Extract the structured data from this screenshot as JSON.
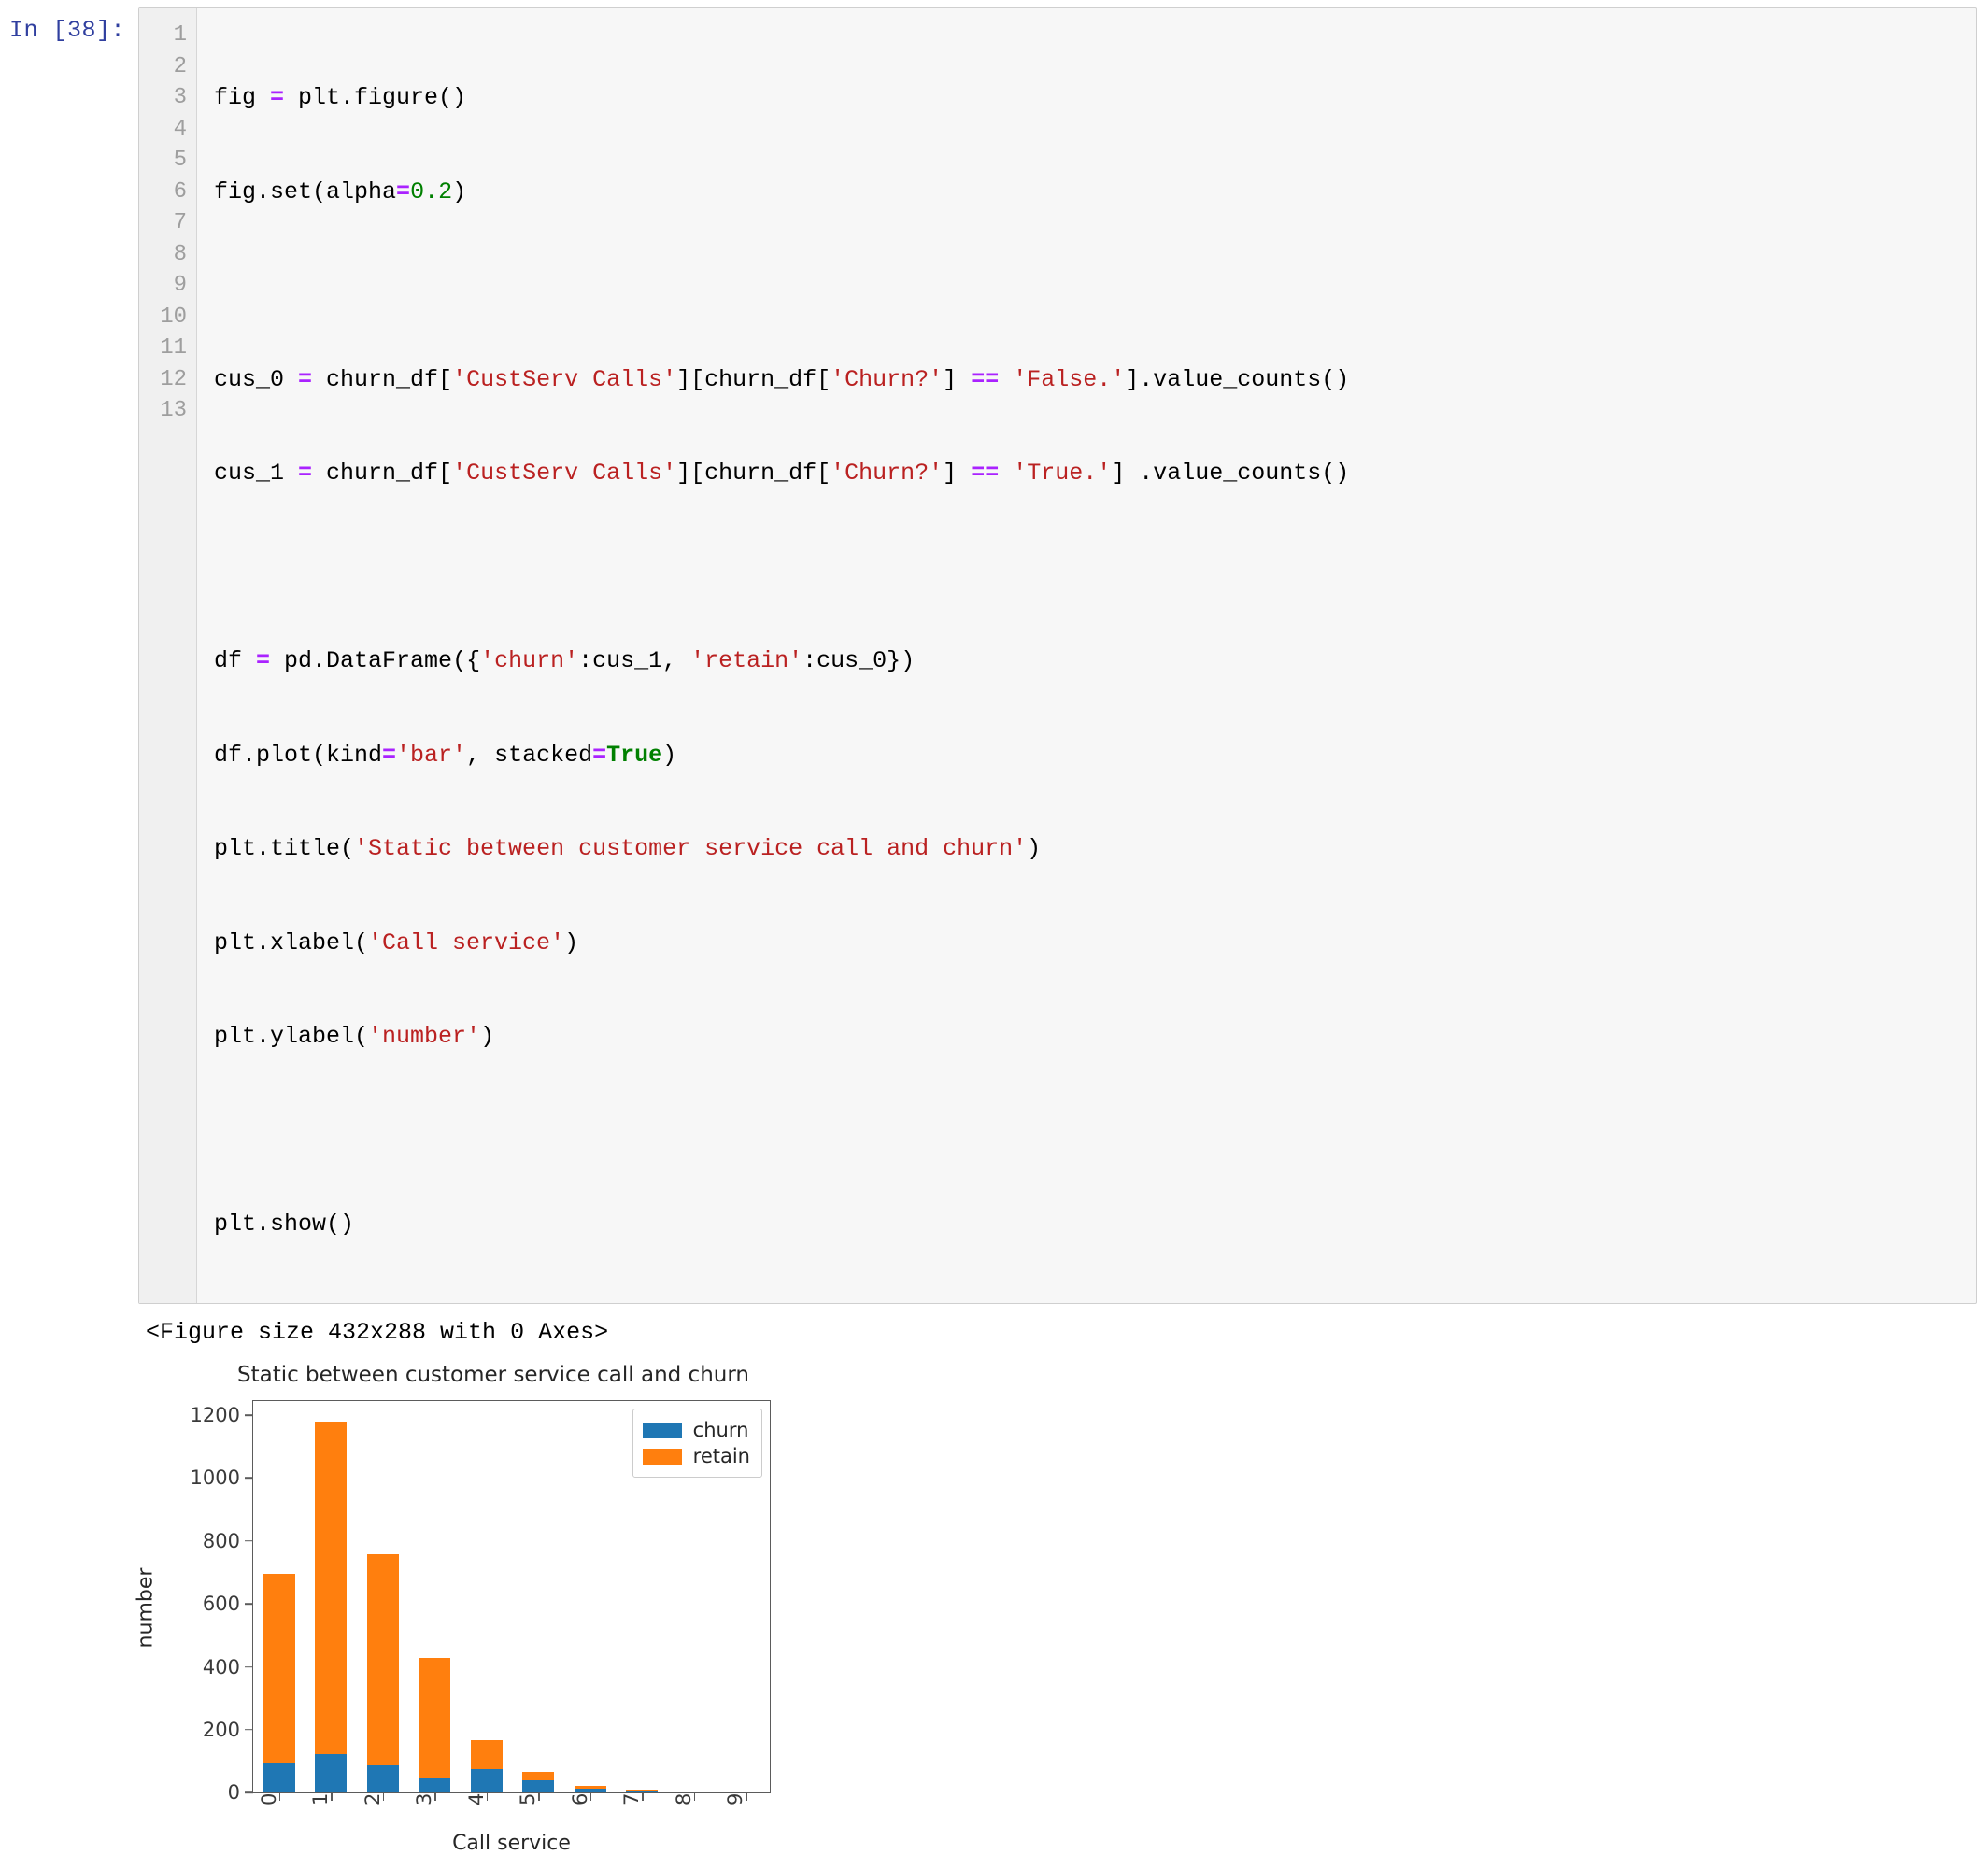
{
  "cell": {
    "prompt": "In [38]:",
    "line_numbers": [
      "1",
      "2",
      "3",
      "4",
      "5",
      "6",
      "7",
      "8",
      "9",
      "10",
      "11",
      "12",
      "13"
    ],
    "code_lines": [
      "fig = plt.figure()",
      "fig.set(alpha=0.2)",
      "",
      "cus_0 = churn_df['CustServ Calls'][churn_df['Churn?'] == 'False.'].value_counts()",
      "cus_1 = churn_df['CustServ Calls'][churn_df['Churn?'] == 'True.'] .value_counts()",
      "",
      "df = pd.DataFrame({'churn':cus_1, 'retain':cus_0})",
      "df.plot(kind='bar', stacked=True)",
      "plt.title('Static between customer service call and churn')",
      "plt.xlabel('Call service')",
      "plt.ylabel('number')",
      "",
      "plt.show()"
    ]
  },
  "output": {
    "stdout_text": "<Figure size 432x288 with 0 Axes>"
  },
  "chart_data": {
    "type": "bar",
    "stacked": true,
    "title": "Static between customer service call and churn",
    "xlabel": "Call service",
    "ylabel": "number",
    "categories": [
      "0",
      "1",
      "2",
      "3",
      "4",
      "5",
      "6",
      "7",
      "8",
      "9"
    ],
    "series": [
      {
        "name": "churn",
        "color": "#1f77b4",
        "values": [
          92,
          122,
          87,
          44,
          76,
          40,
          14,
          5,
          1,
          0
        ]
      },
      {
        "name": "retain",
        "color": "#ff7f0e",
        "values": [
          605,
          1059,
          672,
          385,
          90,
          26,
          8,
          4,
          1,
          0
        ]
      }
    ],
    "totals": [
      697,
      1181,
      759,
      429,
      166,
      66,
      22,
      9,
      2,
      0
    ],
    "ylim": [
      0,
      1250
    ],
    "yticks": [
      "0",
      "200",
      "400",
      "600",
      "800",
      "1000",
      "1200"
    ],
    "ytick_values": [
      0,
      200,
      400,
      600,
      800,
      1000,
      1200
    ],
    "grid": false,
    "legend_position": "upper right"
  },
  "colors": {
    "churn": "#1f77b4",
    "retain": "#ff7f0e",
    "prompt": "#303F9F",
    "string": "#BA2121",
    "operator": "#AA22FF",
    "keyword": "#008000"
  }
}
